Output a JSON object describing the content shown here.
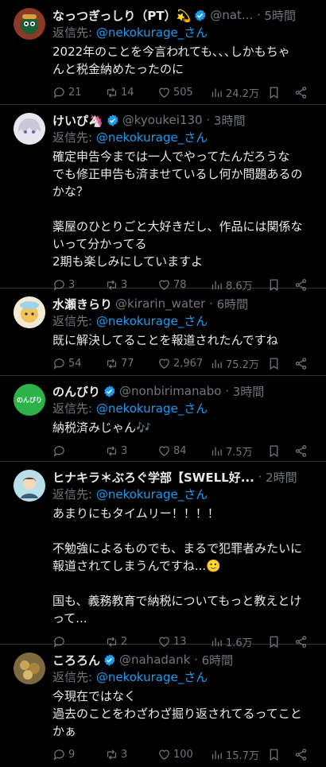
{
  "reply_prefix": "返信先: ",
  "tweets": [
    {
      "name": "なっつぎっしり（PT）💫",
      "handle": "@nat...",
      "time": "5時間",
      "reply_to": "@nekokurage_さん",
      "lines": [
        "2022年のことを今言われても､､､しかもちゃ",
        "んと税金納めたったのに"
      ],
      "replies": "21",
      "reposts": "14",
      "likes": "505",
      "views": "24.2万"
    },
    {
      "name": "けいぴ🦄",
      "handle": "@kyoukei130",
      "time": "3時間",
      "reply_to": "@nekokurage_さん",
      "lines": [
        "確定申告今までは一人でやってたんだろうな",
        "でも修正申告も済ませているし何か問題あるの",
        "かな？",
        "",
        "薬屋のひとりごと大好きだし、作品には関係な",
        "いって分かってる",
        "2期も楽しみにしていますよ"
      ],
      "replies": "3",
      "reposts": "3",
      "likes": "78",
      "views": "8.6万"
    },
    {
      "name": "水瀬きらり",
      "handle": "@kirarin_water",
      "time": "6時間",
      "reply_to": "@nekokurage_さん",
      "lines": [
        "既に解決してることを報道されたんですね"
      ],
      "replies": "54",
      "reposts": "77",
      "likes": "2,967",
      "views": "75.2万"
    },
    {
      "name": "のんびり",
      "handle": "@nonbirimanabo",
      "time": "3時間",
      "reply_to": "@nekokurage_さん",
      "lines": [
        "納税済みじゃん🎶"
      ],
      "replies": "",
      "reposts": "3",
      "likes": "84",
      "views": "7.5万",
      "avatar_text": "のんびり"
    },
    {
      "name": "ヒナキラ＊ぶろぐ学部【SWELL好...",
      "handle": "",
      "time": "2時間",
      "reply_to": "@nekokurage_さん",
      "lines": [
        "あまりにもタイムリー！！！！",
        "",
        "不勉強によるものでも、まるで犯罪者みたいに",
        "報道されてしまうんですね...🙂",
        "",
        "国も、義務教育で納税についてもっと教えとけ",
        "って..."
      ],
      "replies": "",
      "reposts": "2",
      "likes": "13",
      "views": "1.6万"
    },
    {
      "name": "ころろん",
      "handle": "@nahadank",
      "time": "6時間",
      "reply_to": "@nekokurage_さん",
      "lines": [
        "今現在ではなく",
        "過去のことをわざわざ掘り返されてるってこと",
        "かぁ"
      ],
      "replies": "9",
      "reposts": "3",
      "likes": "100",
      "views": "15.7万"
    }
  ],
  "colors": {
    "background": "#000000",
    "text": "#e7e9ea",
    "muted": "#71767b",
    "link": "#1d9bf0",
    "divider": "#2f3336"
  }
}
